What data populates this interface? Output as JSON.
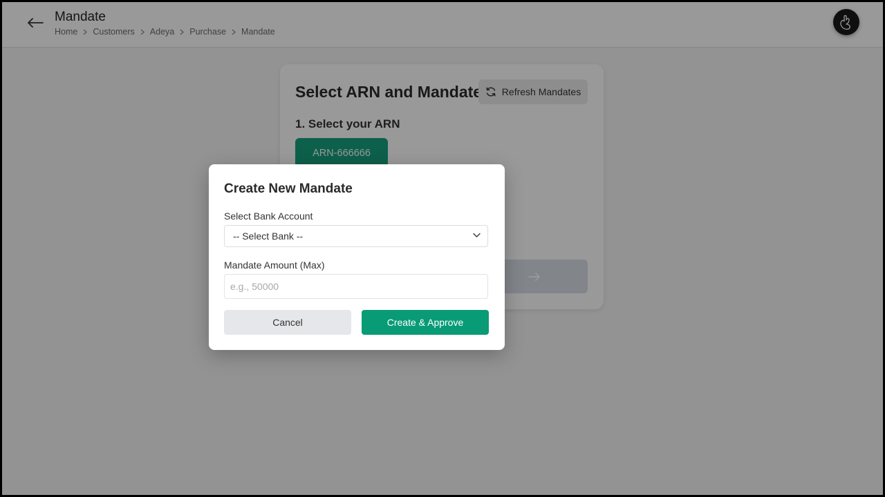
{
  "header": {
    "title": "Mandate",
    "breadcrumb": [
      "Home",
      "Customers",
      "Adeya",
      "Purchase",
      "Mandate"
    ]
  },
  "card": {
    "title": "Select ARN and Mandate",
    "refresh_label": "Refresh Mandates",
    "arn_section_label": "1. Select your ARN",
    "arn_options": [
      "ARN-666666"
    ]
  },
  "modal": {
    "title": "Create New Mandate",
    "bank_label": "Select Bank Account",
    "bank_selected": "-- Select Bank --",
    "amount_label": "Mandate Amount (Max)",
    "amount_placeholder": "e.g., 50000",
    "amount_value": "",
    "cancel_label": "Cancel",
    "create_label": "Create & Approve"
  },
  "colors": {
    "accent": "#099b76",
    "arn_chip": "#17a17d",
    "overlay": "rgba(0,0,0,0.40)"
  },
  "icons": {
    "back": "arrow-left-icon",
    "refresh": "refresh-icon",
    "chevron": "chevron-down-icon",
    "avatar": "hand-logo-icon",
    "continue": "arrow-right-icon"
  }
}
